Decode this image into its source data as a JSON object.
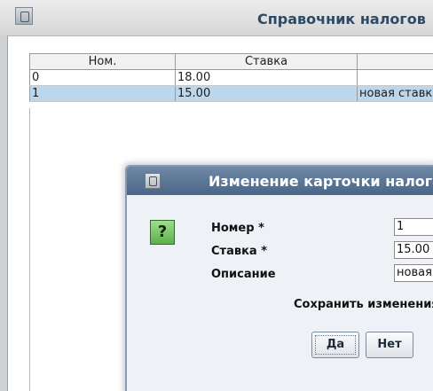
{
  "window": {
    "title": "Справочник налогов"
  },
  "table": {
    "headers": [
      "Ном.",
      "Ставка",
      ""
    ],
    "rows": [
      {
        "num": "0",
        "rate": "18.00",
        "desc": ""
      },
      {
        "num": "1",
        "rate": "15.00",
        "desc": "новая ставка"
      }
    ],
    "selected_row": 1
  },
  "dialog": {
    "title": "Изменение карточки налога",
    "icon": "question-icon",
    "fields": {
      "number": {
        "label": "Номер *",
        "value": "1"
      },
      "rate": {
        "label": "Ставка *",
        "value": "15.00"
      },
      "description": {
        "label": "Описание",
        "value": "новая ставка"
      }
    },
    "message": "Сохранить изменения?",
    "buttons": {
      "yes": "Да",
      "no": "Нет"
    }
  },
  "colors": {
    "selection": "#bcd6ec",
    "dialog_title": "#4a6688",
    "icon_green": "#5fae4b"
  }
}
